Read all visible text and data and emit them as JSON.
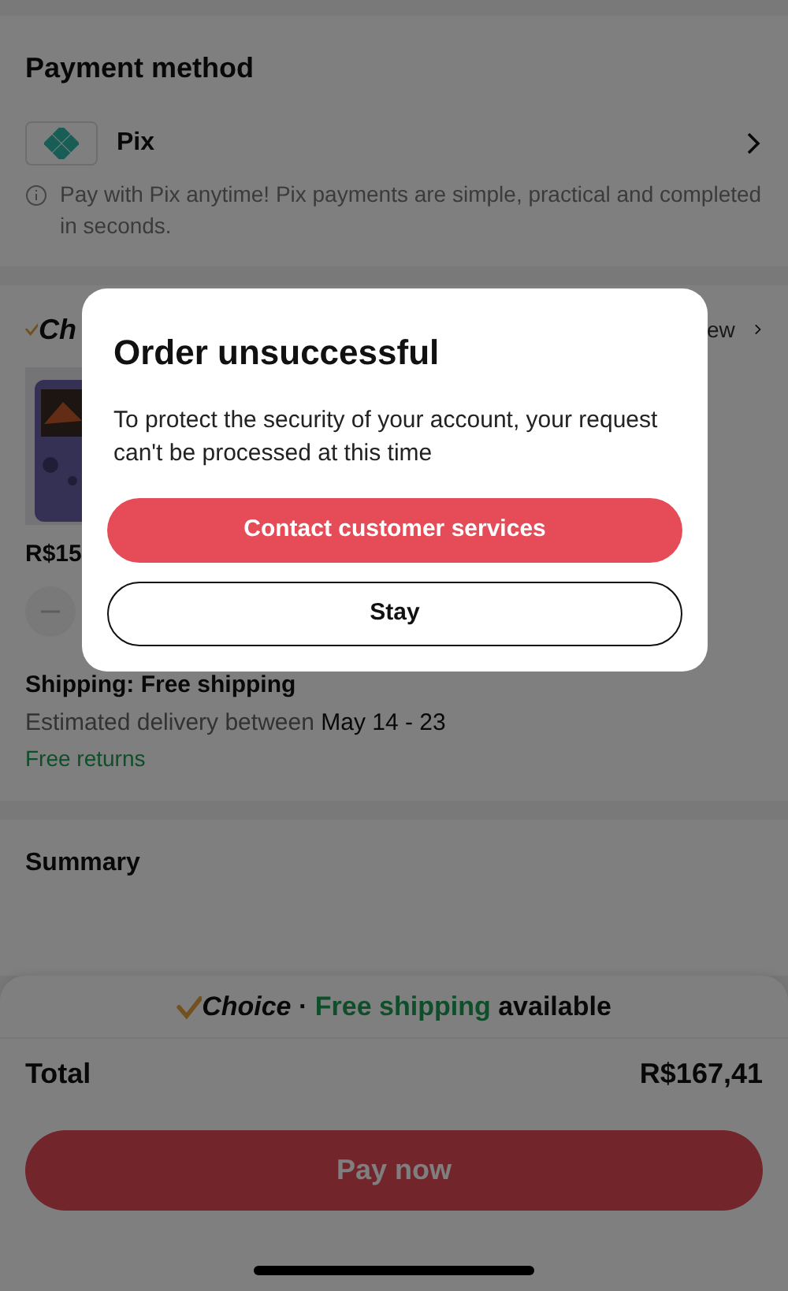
{
  "payment": {
    "title": "Payment method",
    "method": "Pix",
    "note": "Pay with Pix anytime! Pix payments are simple, practical and completed in seconds."
  },
  "items": {
    "logo_partial": "Ch",
    "link_partial": "ew",
    "price_partial": "R$15"
  },
  "shipping": {
    "title": "Shipping: Free shipping",
    "estimate_label": "Estimated delivery between",
    "estimate_dates": "May 14 - 23",
    "returns": "Free returns"
  },
  "summary": {
    "title": "Summary"
  },
  "banner": {
    "brand": "Choice",
    "separator": "·",
    "highlight": "Free shipping",
    "rest": "available"
  },
  "total": {
    "label": "Total",
    "value": "R$167,41"
  },
  "pay_button": "Pay now",
  "dialog": {
    "title": "Order unsuccessful",
    "message": "To protect the security of your account, your request can't be processed at this time",
    "buttons": [
      {
        "label": "Contact customer services",
        "kind": "primary"
      },
      {
        "label": "Stay",
        "kind": "outline"
      }
    ]
  }
}
